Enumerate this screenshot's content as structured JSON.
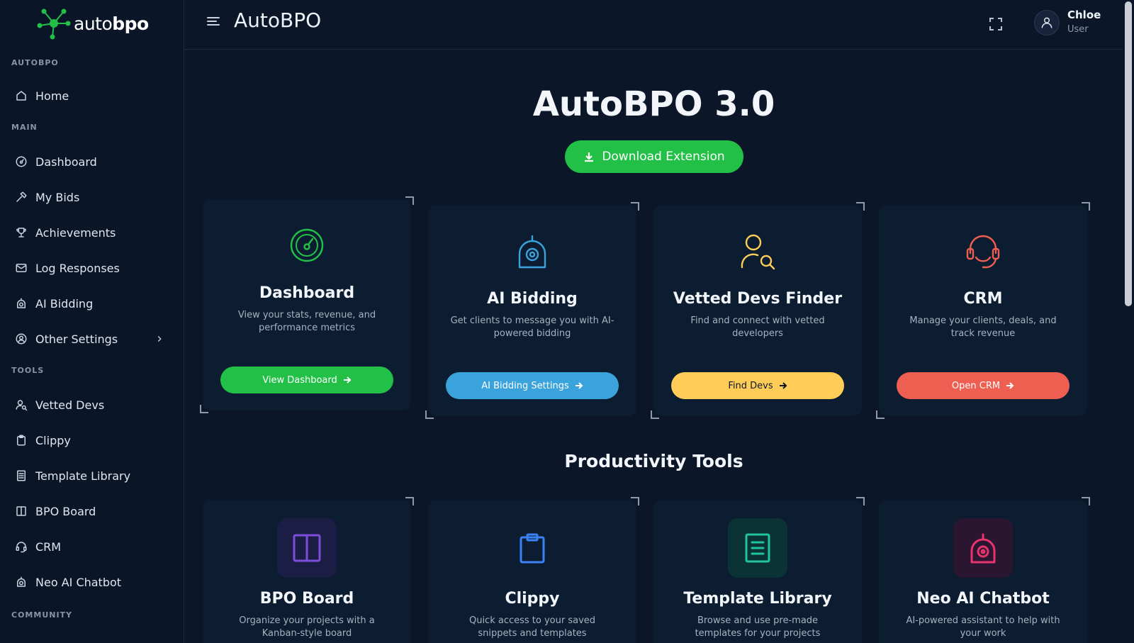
{
  "brand": {
    "logo_prefix": "auto",
    "logo_suffix": "bpo"
  },
  "sidebar": {
    "sections": {
      "autobpo": "AUTOBPO",
      "main": "MAIN",
      "tools": "TOOLS",
      "community": "COMMUNITY"
    },
    "home": {
      "label": "Home",
      "icon": "home-icon"
    },
    "main_items": [
      {
        "label": "Dashboard",
        "icon": "gauge-icon"
      },
      {
        "label": "My Bids",
        "icon": "hammer-icon"
      },
      {
        "label": "Achievements",
        "icon": "trophy-icon"
      },
      {
        "label": "Log Responses",
        "icon": "mail-check-icon"
      },
      {
        "label": "AI Bidding",
        "icon": "robot-icon"
      },
      {
        "label": "Other Settings",
        "icon": "user-circle-icon"
      }
    ],
    "tool_items": [
      {
        "label": "Vetted Devs",
        "icon": "user-search-icon"
      },
      {
        "label": "Clippy",
        "icon": "clipboard-icon"
      },
      {
        "label": "Template Library",
        "icon": "document-icon"
      },
      {
        "label": "BPO Board",
        "icon": "columns-icon"
      },
      {
        "label": "CRM",
        "icon": "headset-icon"
      },
      {
        "label": "Neo AI Chatbot",
        "icon": "robot-icon"
      }
    ]
  },
  "header": {
    "title": "AutoBPO",
    "user_name": "Chloe",
    "user_role": "User"
  },
  "main": {
    "hero_title": "AutoBPO 3.0",
    "download_label": "Download Extension",
    "feature_cards": [
      {
        "title": "Dashboard",
        "desc": "View your stats, revenue, and performance metrics",
        "button": "View Dashboard",
        "icon": "gauge-icon",
        "color": "#22c046"
      },
      {
        "title": "AI Bidding",
        "desc": "Get clients to message you with AI-powered bidding",
        "button": "AI Bidding Settings",
        "icon": "robot-icon",
        "color": "#3aa3dc"
      },
      {
        "title": "Vetted Devs Finder",
        "desc": "Find and connect with vetted developers",
        "button": "Find Devs",
        "icon": "user-search-icon",
        "color": "#ffcd57"
      },
      {
        "title": "CRM",
        "desc": "Manage your clients, deals, and track revenue",
        "button": "Open CRM",
        "icon": "headset-icon",
        "color": "#ee5f52"
      }
    ],
    "productivity_title": "Productivity Tools",
    "tool_cards": [
      {
        "title": "BPO Board",
        "desc": "Organize your projects with a Kanban-style board",
        "icon": "columns-icon",
        "color": "#7c4ddb"
      },
      {
        "title": "Clippy",
        "desc": "Quick access to your saved snippets and templates",
        "icon": "clipboard-icon",
        "color": "#3b82f6"
      },
      {
        "title": "Template Library",
        "desc": "Browse and use pre-made templates for your projects",
        "icon": "document-icon",
        "color": "#22c59a"
      },
      {
        "title": "Neo AI Chatbot",
        "desc": "AI-powered assistant to help with your work",
        "icon": "robot-icon",
        "color": "#e8336f"
      }
    ]
  }
}
